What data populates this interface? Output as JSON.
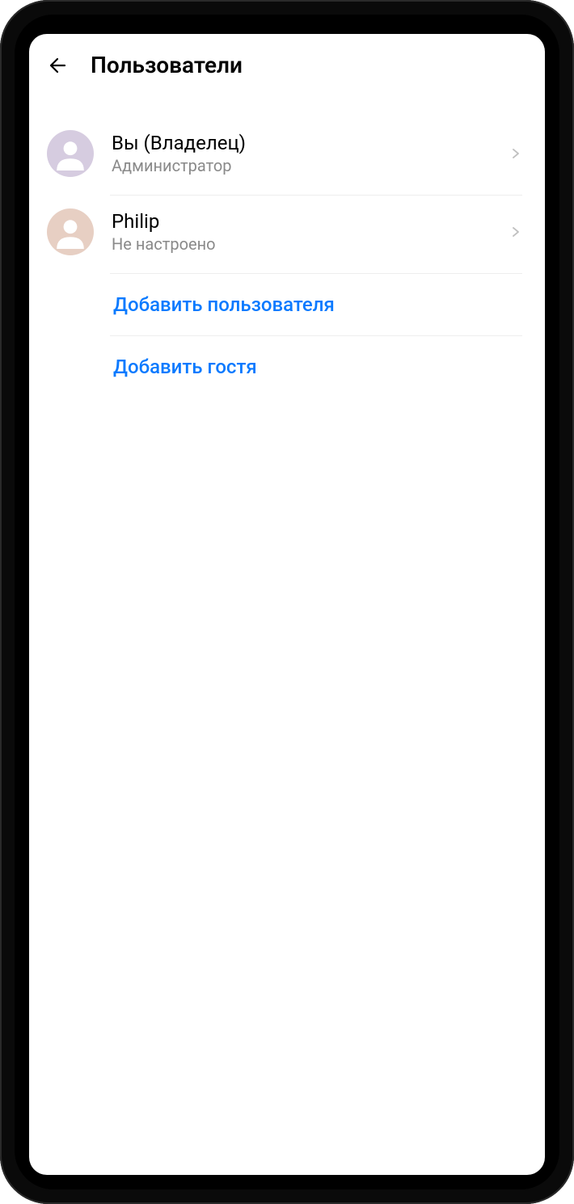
{
  "header": {
    "title": "Пользователи"
  },
  "users": [
    {
      "name": "Вы (Владелец)",
      "subtitle": "Администратор",
      "avatar_color": "purple"
    },
    {
      "name": "Philip",
      "subtitle": "Не настроено",
      "avatar_color": "tan"
    }
  ],
  "actions": {
    "add_user_label": "Добавить пользователя",
    "add_guest_label": "Добавить гостя"
  },
  "colors": {
    "link": "#0a7aff",
    "text_secondary": "#8a8a8a",
    "avatar_purple": "#d6cce0",
    "avatar_tan": "#e7cfc3"
  }
}
